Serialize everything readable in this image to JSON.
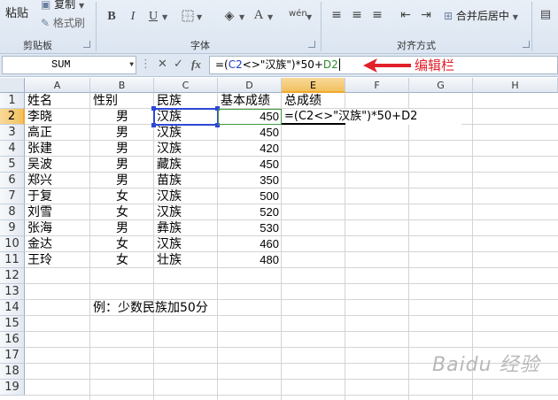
{
  "ribbon": {
    "clipboard": {
      "label": "剪贴板",
      "paste": "粘贴",
      "copy": "复制",
      "format_painter": "格式刷"
    },
    "font": {
      "label": "字体",
      "bold": "B",
      "italic": "I",
      "underline": "U",
      "font_color": "A"
    },
    "alignment": {
      "label": "对齐方式",
      "merge_center": "合并后居中"
    }
  },
  "formula_bar": {
    "name_box": "SUM",
    "cancel_icon": "✕",
    "enter_icon": "✓",
    "fx": "fx",
    "formula_parts": {
      "prefix": "=(",
      "ref1": "C2",
      "middle": "<>\"汉族\")*50+",
      "ref2": "D2"
    }
  },
  "annotation": {
    "label": "编辑栏"
  },
  "sheet": {
    "columns": [
      "A",
      "B",
      "C",
      "D",
      "E",
      "F",
      "G",
      "H"
    ],
    "rows": [
      "1",
      "2",
      "3",
      "4",
      "5",
      "6",
      "7",
      "8",
      "9",
      "10",
      "11",
      "12",
      "13",
      "14",
      "15",
      "16",
      "17",
      "18",
      "19"
    ],
    "headers": {
      "name": "姓名",
      "gender": "性别",
      "ethnicity": "民族",
      "score": "基本成绩",
      "total": "总成绩"
    },
    "records": [
      {
        "name": "李晓",
        "gender": "男",
        "ethnicity": "汉族",
        "score": "450"
      },
      {
        "name": "高正",
        "gender": "男",
        "ethnicity": "汉族",
        "score": "450"
      },
      {
        "name": "张建",
        "gender": "男",
        "ethnicity": "汉族",
        "score": "420"
      },
      {
        "name": "吴波",
        "gender": "男",
        "ethnicity": "藏族",
        "score": "450"
      },
      {
        "name": "郑兴",
        "gender": "男",
        "ethnicity": "苗族",
        "score": "350"
      },
      {
        "name": "于复",
        "gender": "女",
        "ethnicity": "汉族",
        "score": "500"
      },
      {
        "name": "刘雪",
        "gender": "女",
        "ethnicity": "汉族",
        "score": "520"
      },
      {
        "name": "张海",
        "gender": "男",
        "ethnicity": "彝族",
        "score": "530"
      },
      {
        "name": "金达",
        "gender": "女",
        "ethnicity": "汉族",
        "score": "460"
      },
      {
        "name": "王玲",
        "gender": "女",
        "ethnicity": "壮族",
        "score": "480"
      }
    ],
    "e2_formula": "=(C2<>\"汉族\")*50+D2",
    "note": "例：少数民族加50分"
  },
  "watermark": "Baidu 经验",
  "colors": {
    "ribbon_bg": "#dbe5f1",
    "selection_blue": "#2e48d6",
    "selection_green": "#3f9a3f",
    "annotation_red": "#e0202a",
    "header_highlight": "#f1c15f"
  }
}
